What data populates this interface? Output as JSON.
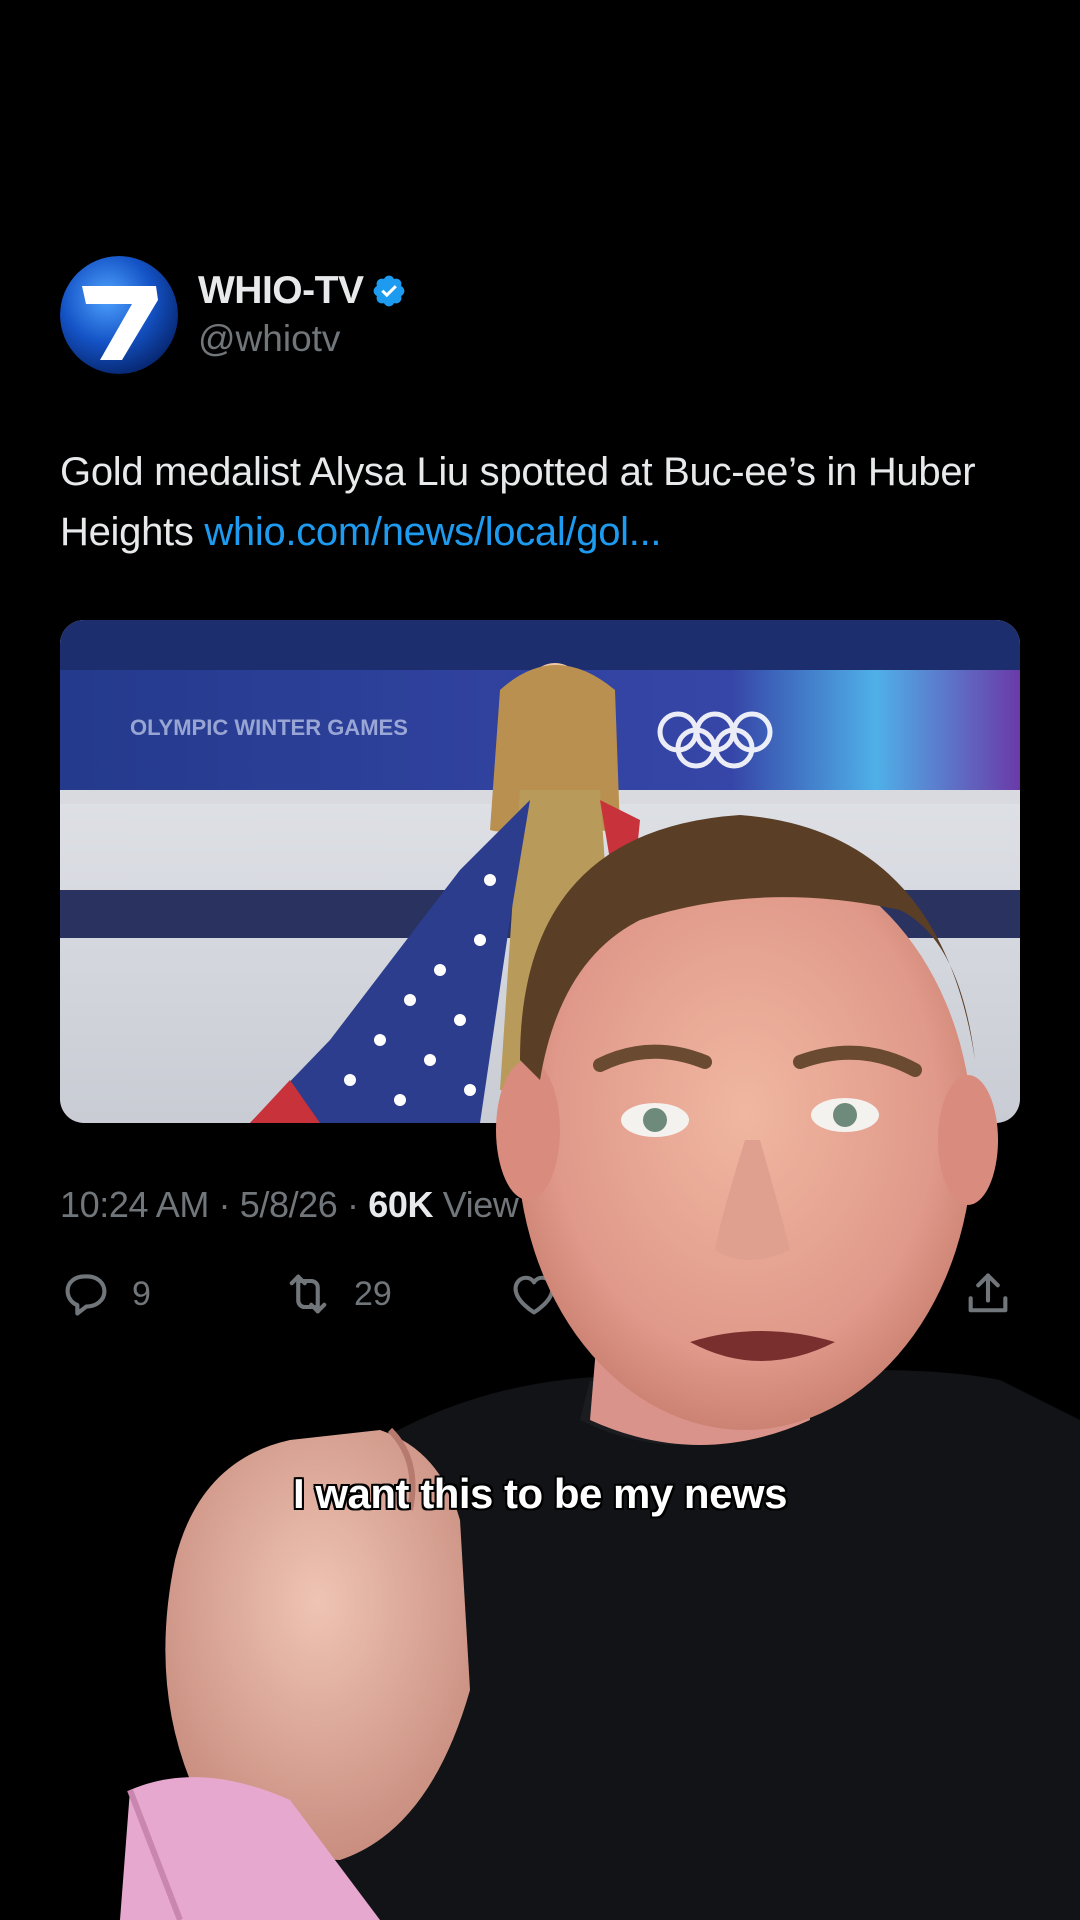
{
  "tweet": {
    "display_name": "WHIO-TV",
    "handle": "@whiotv",
    "avatar_icon": "channel-7-logo",
    "verified_icon": "verified-badge-icon",
    "text": "Gold medalist Alysa Liu spotted at Buc-ee’s in Huber Heights ",
    "link": "whio.com/news/local/gol...",
    "media": {
      "banner_text": "OLYMPIC WINTER GAMES"
    },
    "meta": {
      "time": "10:24 AM",
      "separator": "·",
      "date": "5/8/26",
      "views_count": "60K",
      "views_label": "View"
    },
    "actions": {
      "replies": "9",
      "reposts": "29",
      "reply_icon": "reply-icon",
      "repost_icon": "repost-icon",
      "like_icon": "heart-icon",
      "share_icon": "share-icon"
    }
  },
  "caption": "I want this to be my news",
  "colors": {
    "background": "#000000",
    "text_primary": "#e7e9ea",
    "text_secondary": "#71767b",
    "link": "#1d9bf0",
    "verified": "#1d9bf0"
  }
}
